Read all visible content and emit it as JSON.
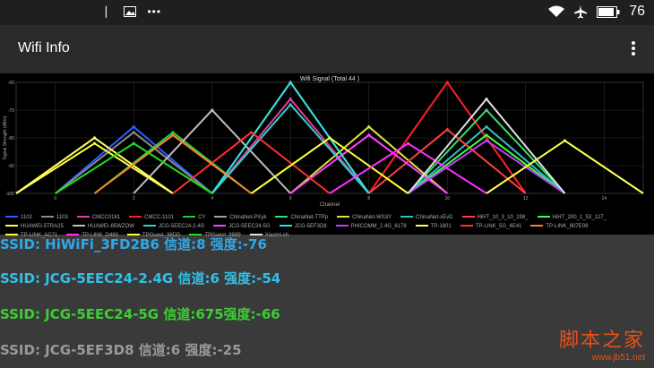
{
  "status_bar": {
    "battery_level": "76",
    "icons": [
      "notification-icon",
      "image-icon",
      "more-dots-icon",
      "wifi-icon",
      "airplane-icon",
      "battery-icon"
    ]
  },
  "app_bar": {
    "title": "Wifi Info"
  },
  "chart_data": {
    "type": "line",
    "title": "Wifi Signal (Total 44 )",
    "xlabel": "Channel",
    "ylabel": "Signal Strength (dBm)",
    "xlim": [
      -1,
      15
    ],
    "ylim": [
      -100,
      -60
    ],
    "xticks": [
      0,
      2,
      4,
      6,
      8,
      10,
      12,
      14
    ],
    "yticks": [
      -60,
      -70,
      -80,
      -90,
      -100
    ],
    "series": [
      {
        "name": "1102",
        "channel": 2,
        "peak": -76,
        "color": "#2a5cff"
      },
      {
        "name": "1103",
        "channel": 2,
        "peak": -78,
        "color": "#8a8a8a"
      },
      {
        "name": "CMCC0181",
        "channel": 6,
        "peak": -66,
        "color": "#e040a0"
      },
      {
        "name": "CMCC-1101",
        "channel": 10,
        "peak": -60,
        "color": "#ff2020"
      },
      {
        "name": "CY",
        "channel": 3,
        "peak": -78,
        "color": "#20d040"
      },
      {
        "name": "ChinaNet-PXyk",
        "channel": 6,
        "peak": -60,
        "color": "#a0a0a0"
      },
      {
        "name": "ChinaNet-TTPp",
        "channel": 11,
        "peak": -70,
        "color": "#30e070"
      },
      {
        "name": "ChinaNet-WS3Y",
        "channel": 8,
        "peak": -76,
        "color": "#e0e040"
      },
      {
        "name": "ChinaNet-xEvD",
        "channel": 11,
        "peak": -76,
        "color": "#30c0c0"
      },
      {
        "name": "HiHT_10_3_10_198_",
        "channel": 10,
        "peak": -77,
        "color": "#ff4040"
      },
      {
        "name": "HiHT_200_1_53_127_",
        "channel": 11,
        "peak": -79,
        "color": "#40ff40"
      },
      {
        "name": "HUAWEI-5TRA25",
        "channel": 1,
        "peak": -82,
        "color": "#ffff40"
      },
      {
        "name": "HUAWEI-85WZOW",
        "channel": 4,
        "peak": -70,
        "color": "#c0c0c0"
      },
      {
        "name": "JCG-5EEC24-2.4G",
        "channel": 6,
        "peak": -68,
        "color": "#30d0d0"
      },
      {
        "name": "JCG-5EEC24-5G",
        "channel": 8,
        "peak": -79,
        "color": "#ff40ff"
      },
      {
        "name": "JCG-5EF3D8",
        "channel": 6,
        "peak": -60,
        "color": "#30e0e0"
      },
      {
        "name": "PHICOMM_2.4G_6178",
        "channel": 11,
        "peak": -81,
        "color": "#c040ff"
      },
      {
        "name": "TP-1801",
        "channel": 1,
        "peak": -80,
        "color": "#ffff60"
      },
      {
        "name": "TP-LINK_5G_4E41",
        "channel": 5,
        "peak": -78,
        "color": "#ff3030"
      },
      {
        "name": "TP-LINK_807E08",
        "channel": 3,
        "peak": -79,
        "color": "#ff8030"
      },
      {
        "name": "TP-LINK_AC71",
        "channel": 7,
        "peak": -80,
        "color": "#ffff30"
      },
      {
        "name": "TP-LINK_D480",
        "channel": 9,
        "peak": -82,
        "color": "#ff30ff"
      },
      {
        "name": "TPGuest_38DD",
        "channel": 13,
        "peak": -81,
        "color": "#ffff50"
      },
      {
        "name": "TPGuest_9889",
        "channel": 2,
        "peak": -82,
        "color": "#20e020"
      },
      {
        "name": "Xiaomi.sh",
        "channel": 11,
        "peak": -66,
        "color": "#e0e0e0"
      }
    ]
  },
  "ssid_list": [
    {
      "text": "SSID: HiWiFi_3FD2B6  信道:8  强度:-76",
      "color": "#30a8e8"
    },
    {
      "text": "SSID: JCG-5EEC24-2.4G  信道:6  强度:-54",
      "color": "#30c0e8"
    },
    {
      "text": "SSID: JCG-5EEC24-5G  信道:675强度:-66",
      "color": "#3ad032"
    },
    {
      "text": "SSID: JCG-5EF3D8 信道:6  强度:-25",
      "color": "#9a9a9a"
    }
  ],
  "watermark": {
    "brand": "脚本之家",
    "url": "www.jb51.net"
  }
}
